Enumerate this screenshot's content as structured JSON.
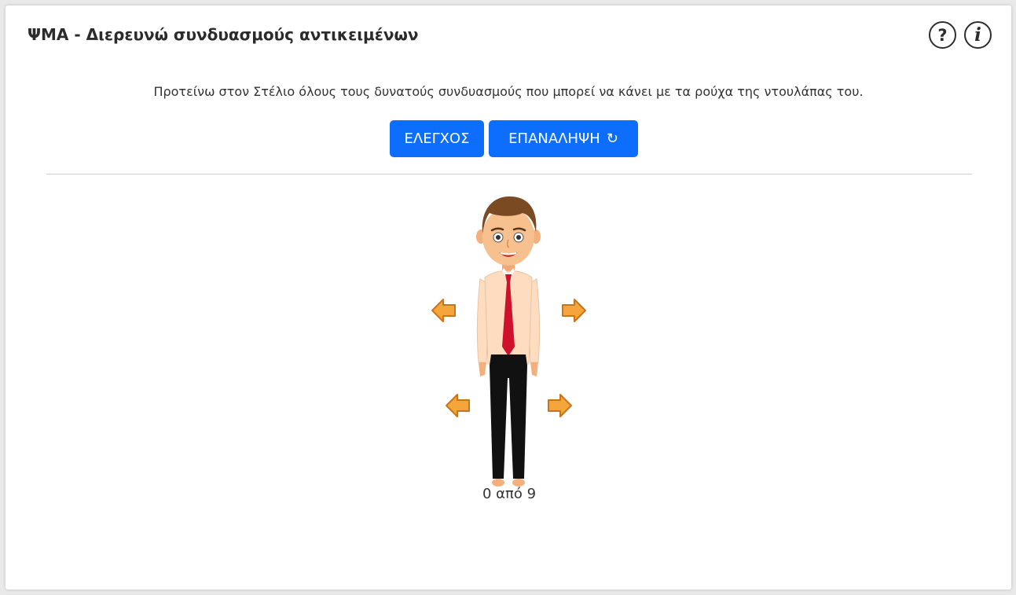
{
  "header": {
    "title": "ΨΜΑ - Διερευνώ συνδυασμούς αντικειμένων",
    "help_symbol": "?",
    "info_symbol": "i",
    "icons": [
      "help-icon",
      "info-icon"
    ]
  },
  "instruction": "Προτείνω στον Στέλιο όλους τους δυνατούς συνδυασμούς που μπορεί να κάνει με τα ρούχα της ντουλάπας του.",
  "buttons": {
    "check_label": "ΕΛΕΓΧΟΣ",
    "repeat_label": "ΕΠΑΝΑΛΗΨΗ",
    "repeat_icon": "↻"
  },
  "character": {
    "icons": [
      "character-figure",
      "arrow-left-icon",
      "arrow-right-icon"
    ]
  },
  "counter": "0 από 9",
  "colors": {
    "accent": "#0d6efd",
    "arrow_fill": "#f6a53a",
    "arrow_stroke": "#c8741c",
    "tie": "#d0112b",
    "shirt": "#fddcc0",
    "trousers": "#111111",
    "hair": "#7a4a22",
    "skin": "#f7c08f"
  }
}
